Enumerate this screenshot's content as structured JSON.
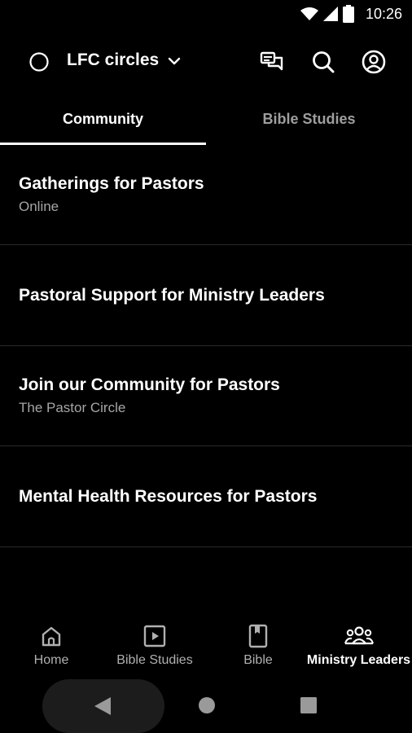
{
  "status_bar": {
    "time": "10:26"
  },
  "app_bar": {
    "title": "LFC circles"
  },
  "tabs": [
    {
      "label": "Community",
      "active": true
    },
    {
      "label": "Bible Studies",
      "active": false
    }
  ],
  "list": [
    {
      "title": "Gatherings for Pastors",
      "subtitle": "Online"
    },
    {
      "title": "Pastoral Support for Ministry Leaders",
      "subtitle": ""
    },
    {
      "title": "Join our Community for Pastors",
      "subtitle": "The Pastor Circle"
    },
    {
      "title": "Mental Health Resources for Pastors",
      "subtitle": ""
    }
  ],
  "bottom_nav": [
    {
      "label": "Home",
      "icon": "home-icon",
      "active": false
    },
    {
      "label": "Bible Studies",
      "icon": "play-icon",
      "active": false
    },
    {
      "label": "Bible",
      "icon": "book-icon",
      "active": false
    },
    {
      "label": "Ministry Leaders",
      "icon": "people-icon",
      "active": true
    }
  ],
  "colors": {
    "background": "#000000",
    "text": "#ffffff",
    "muted": "#a6a6a6",
    "divider": "#2a2a2a"
  }
}
